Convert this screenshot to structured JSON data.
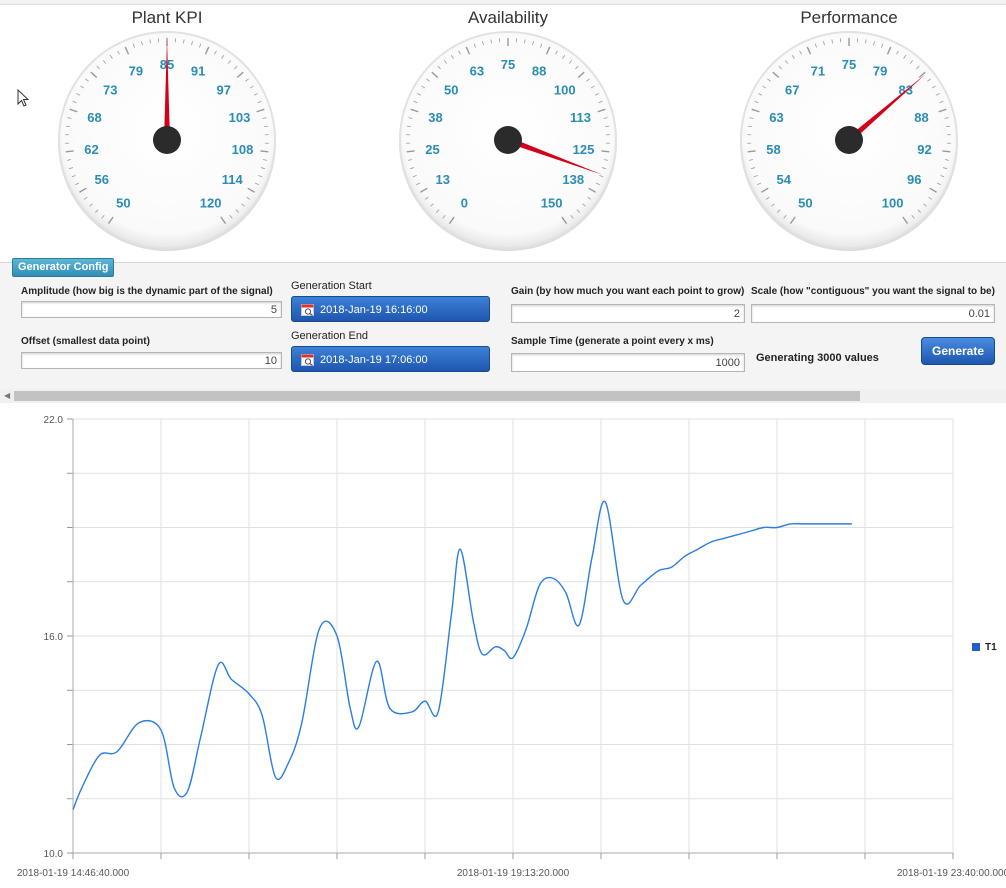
{
  "gauges": [
    {
      "title": "Plant KPI",
      "ticks": [
        "50",
        "56",
        "62",
        "68",
        "73",
        "79",
        "85",
        "91",
        "97",
        "103",
        "108",
        "114",
        "120"
      ],
      "min": 50,
      "max": 120,
      "value": 85,
      "needle_color": "#d4001a"
    },
    {
      "title": "Availability",
      "ticks": [
        "0",
        "13",
        "25",
        "38",
        "50",
        "63",
        "75",
        "88",
        "100",
        "113",
        "125",
        "138",
        "150"
      ],
      "min": 0,
      "max": 150,
      "value": 132,
      "needle_color": "#d4001a"
    },
    {
      "title": "Performance",
      "ticks": [
        "50",
        "54",
        "58",
        "63",
        "67",
        "71",
        "75",
        "79",
        "83",
        "88",
        "92",
        "96",
        "100"
      ],
      "min": 50,
      "max": 100,
      "value": 83.5,
      "needle_color": "#d4001a"
    }
  ],
  "config": {
    "tab_label": "Generator Config",
    "amplitude_label": "Amplitude (how big is the dynamic part of the signal)",
    "amplitude_value": "5",
    "offset_label": "Offset (smallest data point)",
    "offset_value": "10",
    "gen_start_label": "Generation Start",
    "gen_start_value": "2018-Jan-19 16:16:00",
    "gen_end_label": "Generation End",
    "gen_end_value": "2018-Jan-19 17:06:00",
    "gain_label": "Gain (by how much you want each point to grow)",
    "gain_value": "2",
    "scale_label": "Scale (how \"contiguous\" you want the signal to be)",
    "scale_value": "0.01",
    "sample_label": "Sample Time (generate a point every x ms)",
    "sample_value": "1000",
    "status": "Generating 3000 values",
    "generate_label": "Generate"
  },
  "chart_data": {
    "type": "line",
    "y_ticks": [
      "10.0",
      "16.0",
      "22.0"
    ],
    "ylim": [
      10,
      22
    ],
    "x_ticks": [
      "2018-01-19 14:46:40.000",
      "2018-01-19 19:13:20.000",
      "2018-01-19 23:40:00.000"
    ],
    "grid": true,
    "legend_position": "right",
    "series": [
      {
        "name": "T1",
        "color": "#2b7de0",
        "x": [
          0,
          0.01,
          0.03,
          0.05,
          0.075,
          0.1,
          0.115,
          0.13,
          0.145,
          0.165,
          0.18,
          0.2,
          0.215,
          0.23,
          0.245,
          0.26,
          0.28,
          0.3,
          0.315,
          0.325,
          0.345,
          0.36,
          0.385,
          0.4,
          0.415,
          0.43,
          0.44,
          0.455,
          0.465,
          0.48,
          0.49,
          0.5,
          0.515,
          0.53,
          0.545,
          0.56,
          0.575,
          0.59,
          0.605,
          0.625,
          0.645,
          0.665,
          0.68,
          0.695,
          0.71,
          0.725,
          0.74,
          0.755,
          0.77,
          0.785,
          0.8,
          0.815,
          0.83,
          0.84,
          0.855,
          0.865,
          0.875,
          0.885
        ],
        "y": [
          11.2,
          11.8,
          12.7,
          12.8,
          13.6,
          13.4,
          11.8,
          11.7,
          13.2,
          15.2,
          14.8,
          14.4,
          13.8,
          12.1,
          12.5,
          13.6,
          16.2,
          16.0,
          14.0,
          13.5,
          15.3,
          14.0,
          13.9,
          14.2,
          13.9,
          16.6,
          18.4,
          16.4,
          15.5,
          15.7,
          15.6,
          15.4,
          16.2,
          17.4,
          17.6,
          17.2,
          16.3,
          18.2,
          19.7,
          17.0,
          17.4,
          17.8,
          17.9,
          18.2,
          18.4,
          18.6,
          18.7,
          18.8,
          18.9,
          19.0,
          19.0,
          19.1,
          19.1,
          19.1,
          19.1,
          19.1,
          19.1,
          19.1
        ]
      }
    ]
  }
}
